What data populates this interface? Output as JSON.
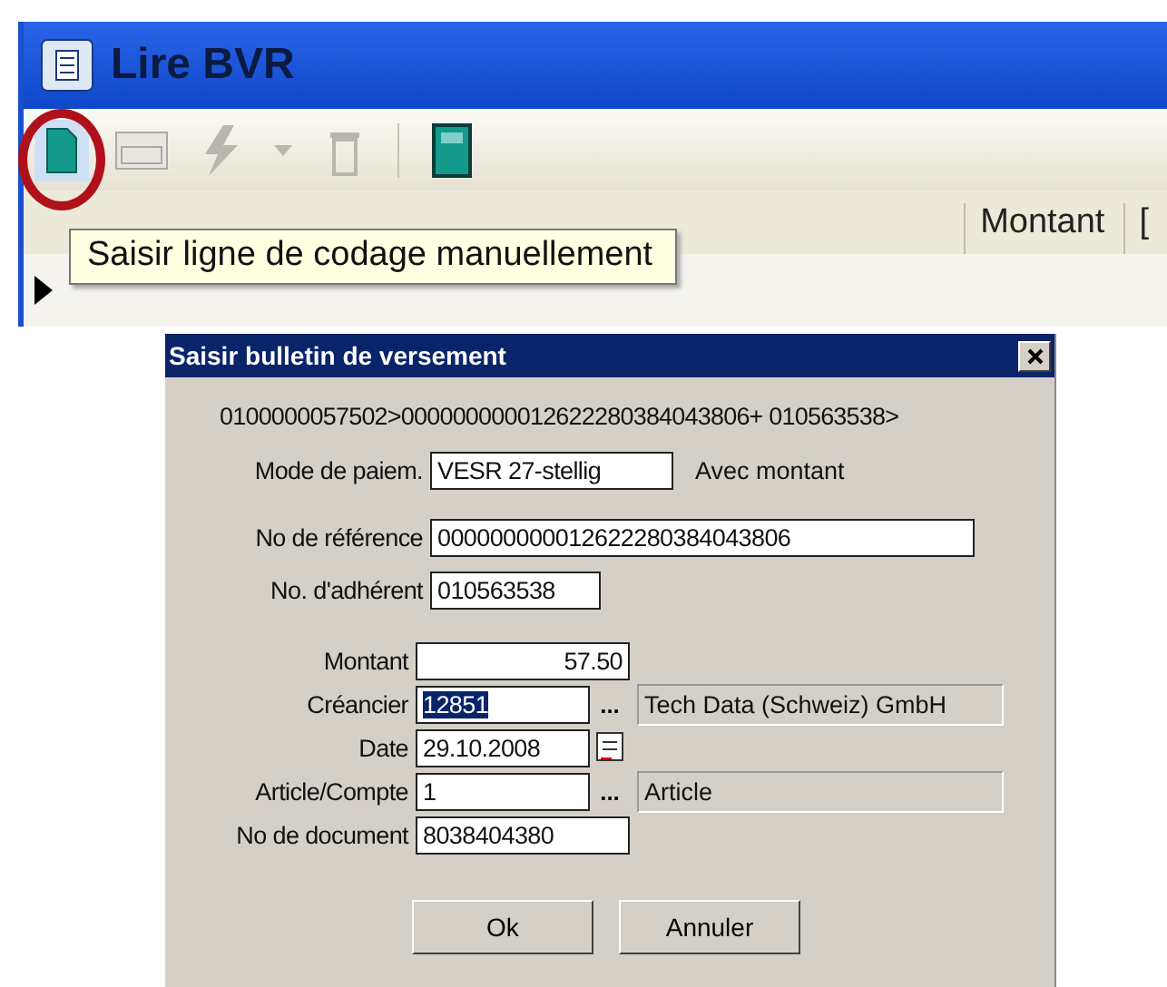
{
  "window": {
    "title": "Lire BVR"
  },
  "toolbar": {
    "tooltip": "Saisir ligne de codage manuellement",
    "buttons": [
      {
        "kind": "document",
        "highlighted": true
      },
      {
        "kind": "form",
        "highlighted": false
      },
      {
        "kind": "lightning",
        "highlighted": false
      },
      {
        "kind": "trash",
        "highlighted": false
      },
      {
        "kind": "door",
        "highlighted": false
      }
    ]
  },
  "table": {
    "columns": [
      "Montant",
      "["
    ]
  },
  "dialog": {
    "title": "Saisir bulletin de versement",
    "coding_line": "0100000057502>000000000012622280384043806+ 010563538>",
    "payment_mode": {
      "label": "Mode de paiem.",
      "value": "VESR 27-stellig",
      "note": "Avec montant"
    },
    "reference": {
      "label": "No de référence",
      "value": "000000000012622280384043806"
    },
    "member": {
      "label": "No. d'adhérent",
      "value": "010563538"
    },
    "fields": [
      {
        "kind": "amount",
        "label": "Montant",
        "value": "57.50"
      },
      {
        "kind": "lookup",
        "label": "Créancier",
        "value": "12851",
        "selected": true,
        "button": "...",
        "info": "Tech Data (Schweiz) GmbH"
      },
      {
        "kind": "date",
        "label": "Date",
        "value": "29.10.2008",
        "selected": false
      },
      {
        "kind": "lookup",
        "label": "Article/Compte",
        "value": "1",
        "selected": false,
        "button": "...",
        "info": "Article"
      },
      {
        "kind": "plain",
        "label": "No de document",
        "value": "8038404380"
      }
    ],
    "buttons": [
      "Ok",
      "Annuler"
    ]
  }
}
